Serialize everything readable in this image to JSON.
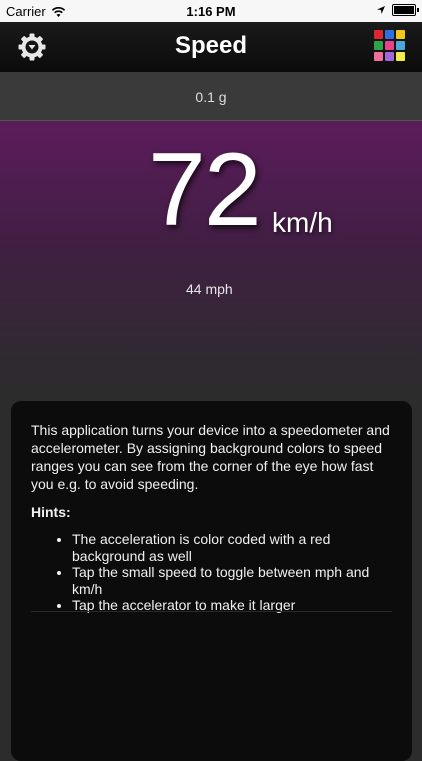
{
  "status_bar": {
    "carrier": "Carrier",
    "time": "1:16 PM",
    "icons": [
      "wifi-icon",
      "location-icon",
      "battery-icon"
    ]
  },
  "nav": {
    "title": "Speed",
    "left_icon": "settings-gear-icon",
    "right_icon": "color-grid-icon",
    "color_grid": [
      "#e0262d",
      "#2e6fe3",
      "#f1c81d",
      "#2ea447",
      "#e93f8f",
      "#4aa9d9",
      "#ee6f98",
      "#a266d9",
      "#f2ea4a"
    ]
  },
  "acceleration": {
    "value": "0.1 g"
  },
  "speed": {
    "value": "72",
    "unit": "km/h",
    "alt_value": "44 mph",
    "background_color": "#5c1c5c"
  },
  "info": {
    "description": "This application turns your device into a speedometer and accelerometer. By assigning background colors to speed ranges you can see from the corner of the eye how fast you e.g. to avoid speeding.",
    "hints_title": "Hints:",
    "hints": [
      "The acceleration is color coded with a red background as well",
      "Tap the small speed to toggle between mph and km/h",
      "Tap the accelerator to make it larger"
    ]
  }
}
